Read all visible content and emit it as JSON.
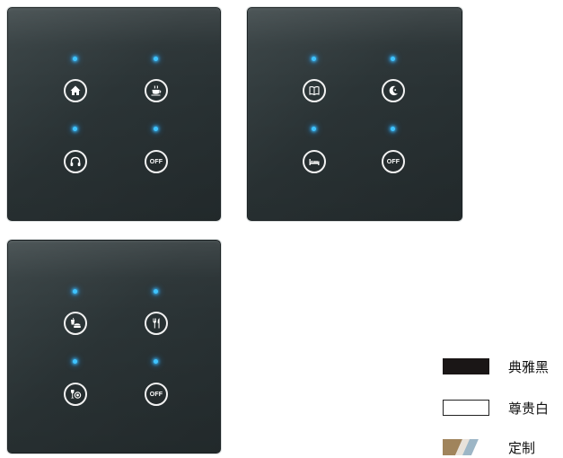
{
  "panels": [
    {
      "buttons": [
        {
          "icon": "home-icon"
        },
        {
          "icon": "coffee-cup-icon"
        },
        {
          "icon": "headphones-icon"
        },
        {
          "icon": "off-icon",
          "label": "OFF"
        }
      ]
    },
    {
      "buttons": [
        {
          "icon": "book-icon"
        },
        {
          "icon": "moon-icon"
        },
        {
          "icon": "bed-icon"
        },
        {
          "icon": "off-icon",
          "label": "OFF"
        }
      ]
    },
    {
      "buttons": [
        {
          "icon": "drink-food-icon"
        },
        {
          "icon": "fork-knife-icon"
        },
        {
          "icon": "wine-plate-icon"
        },
        {
          "icon": "off-icon",
          "label": "OFF"
        }
      ]
    }
  ],
  "colors": {
    "panel": "#2b3436",
    "indicator": "#3fc4ff",
    "elegant_black": "#1a1616",
    "noble_white": "#ffffff"
  },
  "legend": {
    "elegant_black": "典雅黑",
    "noble_white": "尊贵白",
    "custom": "定制"
  }
}
